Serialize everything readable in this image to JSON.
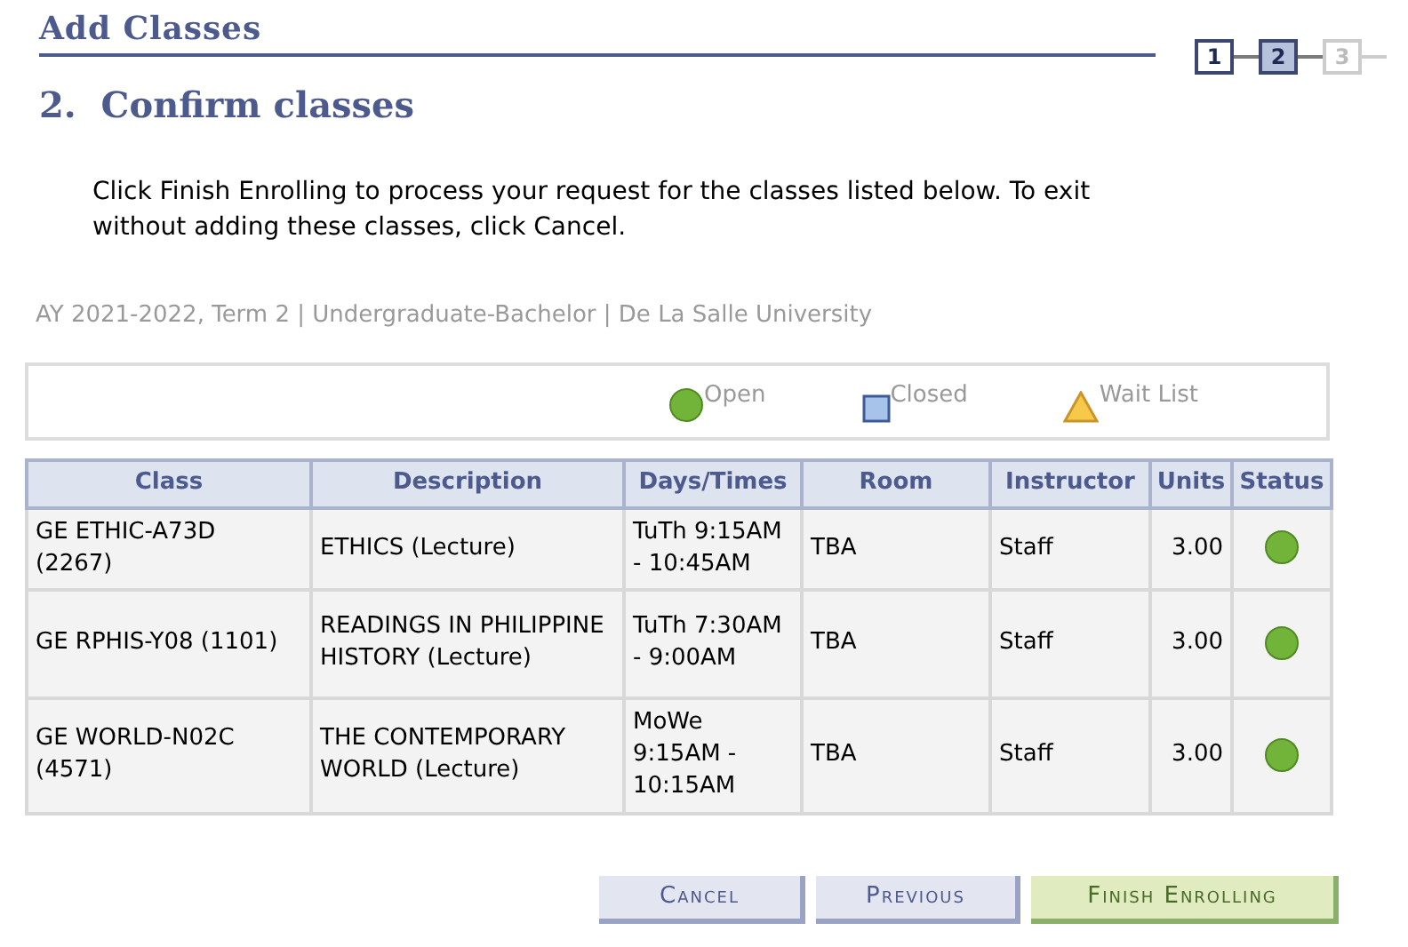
{
  "page_title": "Add Classes",
  "steps": [
    {
      "label": "1",
      "selected": false,
      "disabled": false
    },
    {
      "label": "2",
      "selected": true,
      "disabled": false
    },
    {
      "label": "3",
      "selected": false,
      "disabled": true
    }
  ],
  "heading": "2.  Confirm classes",
  "instructions": "Click Finish Enrolling to process your request for the classes listed below. To exit without adding these classes, click Cancel.",
  "term_info": "AY 2021-2022, Term 2 | Undergraduate-Bachelor | De La Salle University",
  "legend": [
    {
      "kind": "open",
      "label": "Open"
    },
    {
      "kind": "closed",
      "label": "Closed"
    },
    {
      "kind": "waitlist",
      "label": "Wait List"
    }
  ],
  "table": {
    "columns": [
      "Class",
      "Description",
      "Days/Times",
      "Room",
      "Instructor",
      "Units",
      "Status"
    ],
    "rows": [
      {
        "class": "GE ETHIC-A73D (2267)",
        "description": "ETHICS (Lecture)",
        "days_times": "TuTh 9:15AM - 10:45AM",
        "room": "TBA",
        "instructor": "Staff",
        "units": "3.00",
        "status": {
          "kind": "open"
        }
      },
      {
        "class": "GE RPHIS-Y08 (1101)",
        "description": "READINGS IN PHILIPPINE HISTORY (Lecture)",
        "days_times": "TuTh 7:30AM - 9:00AM",
        "room": "TBA",
        "instructor": "Staff",
        "units": "3.00",
        "status": {
          "kind": "open"
        }
      },
      {
        "class": "GE WORLD-N02C (4571)",
        "description": "THE CONTEMPORARY WORLD (Lecture)",
        "days_times": "MoWe 9:15AM - 10:15AM",
        "room": "TBA",
        "instructor": "Staff",
        "units": "3.00",
        "status": {
          "kind": "open"
        }
      }
    ]
  },
  "buttons": [
    {
      "label": "Cancel",
      "kind": "normal"
    },
    {
      "label": "Previous",
      "kind": "normal"
    },
    {
      "label": "Finish Enrolling",
      "kind": "primary"
    }
  ]
}
